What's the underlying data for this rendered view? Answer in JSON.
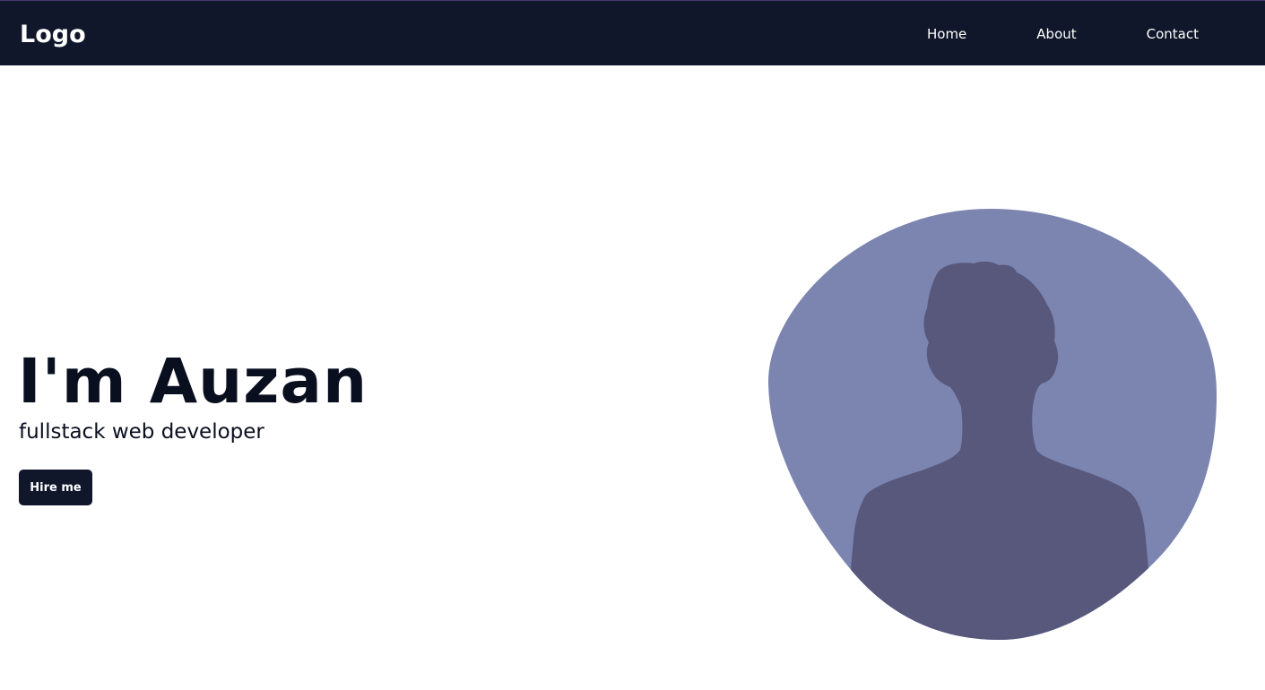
{
  "header": {
    "logo": "Logo",
    "nav": [
      {
        "label": "Home"
      },
      {
        "label": "About"
      },
      {
        "label": "Contact"
      }
    ]
  },
  "hero": {
    "title": "I'm Auzan",
    "subtitle": "fullstack web developer",
    "cta_label": "Hire me"
  },
  "avatar": {
    "icon": "person-silhouette-icon"
  },
  "colors": {
    "navbar_bg": "#11172b",
    "button_bg": "#11172b",
    "blob_bg": "#7b85b0",
    "silhouette": "#58587d",
    "text_dark": "#0a0f1f"
  }
}
